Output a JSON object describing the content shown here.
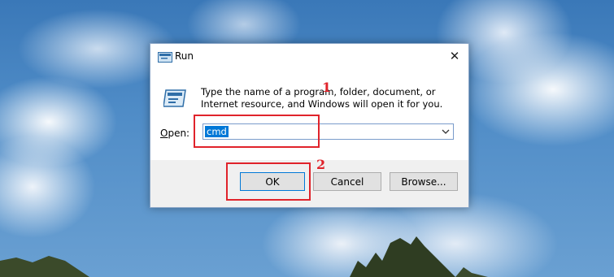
{
  "dialog": {
    "title": "Run",
    "close_glyph": "✕",
    "description": "Type the name of a program, folder, document, or Internet resource, and Windows will open it for you.",
    "open_label_underlined": "O",
    "open_label_rest": "pen:",
    "open_value": "cmd",
    "buttons": {
      "ok": "OK",
      "cancel": "Cancel",
      "browse": "Browse..."
    },
    "icons": [
      "run-icon",
      "close-icon",
      "run-large-icon",
      "chevron-down-icon"
    ]
  },
  "annotations": {
    "step1": "1",
    "step2": "2",
    "color": "#e0232b"
  },
  "colors": {
    "selection": "#0078d7",
    "button_face": "#e1e1e1",
    "footer": "#f0f0f0"
  }
}
